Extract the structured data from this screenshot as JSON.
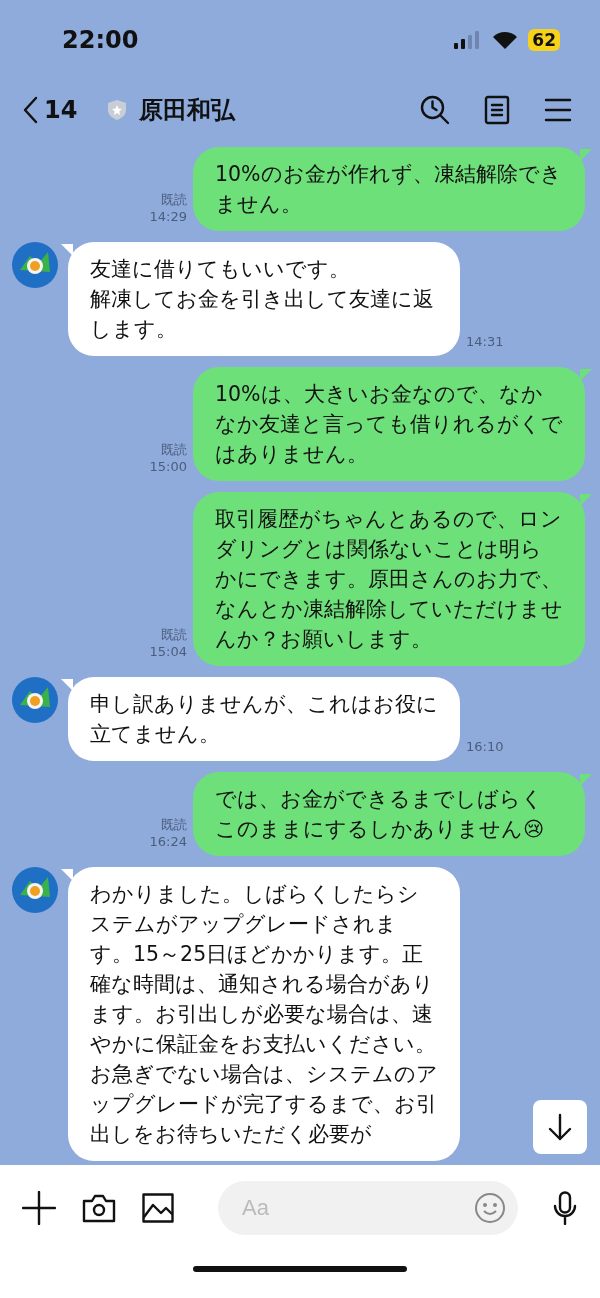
{
  "status_bar": {
    "time": "22:00",
    "battery": "62"
  },
  "header": {
    "back_count": "14",
    "title": "原田和弘"
  },
  "messages": [
    {
      "kind": "sent",
      "paragraphs": [
        "10%のお金が作れず、凍結解除できません。"
      ],
      "read": "既読",
      "time": "14:29"
    },
    {
      "kind": "received",
      "paragraphs": [
        "友達に借りてもいいです。",
        "解凍してお金を引き出して友達に返します。"
      ],
      "time": "14:31"
    },
    {
      "kind": "sent",
      "paragraphs": [
        "10%は、大きいお金なので、なかなか友達と言っても借りれるがくではありません。"
      ],
      "read": "既読",
      "time": "15:00"
    },
    {
      "kind": "sent",
      "paragraphs": [
        "取引履歴がちゃんとあるので、ロンダリングとは関係ないことは明らかにできます。原田さんのお力で、なんとか凍結解除していただけませんか？お願いします。"
      ],
      "read": "既読",
      "time": "15:04"
    },
    {
      "kind": "received",
      "paragraphs": [
        "申し訳ありませんが、これはお役に立てません。"
      ],
      "time": "16:10"
    },
    {
      "kind": "sent",
      "paragraphs": [
        "では、お金ができるまでしばらくこのままにするしかありません😢"
      ],
      "read": "既読",
      "time": "16:24"
    },
    {
      "kind": "received",
      "paragraphs": [
        "わかりました。しばらくしたらシステムがアップグレードされます。15～25日ほどかかります。正確な時間は、通知される場合があります。お引出しが必要な場合は、速やかに保証金をお支払いください。",
        "お急ぎでない場合は、システムのアップグレードが完了するまで、お引出しをお待ちいただく必要が"
      ]
    }
  ],
  "input": {
    "placeholder": "Aa"
  }
}
